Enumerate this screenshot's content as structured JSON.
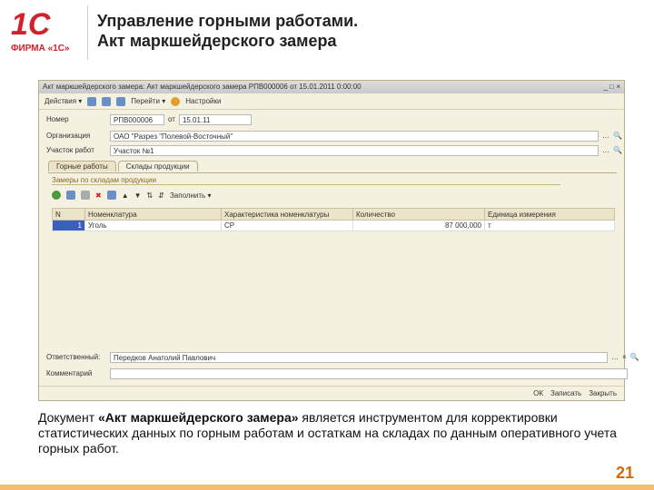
{
  "logo": {
    "mark": "1С",
    "text": "ФИРМА «1С»"
  },
  "title": {
    "line1": "Управление горными работами.",
    "line2": "Акт маркшейдерского замера"
  },
  "window": {
    "title": "Акт маркшейдерского замера: Акт маркшейдерского замера РПВ000006 от 15.01.2011 0:00:00",
    "toolbar": {
      "actions": "Действия ▾",
      "goto": "Перейти ▾",
      "settings": "Настройки"
    },
    "fields": {
      "number_label": "Номер",
      "number": "РПВ000006",
      "date_label": "от",
      "date": "15.01.11",
      "org_label": "Организация",
      "org": "ОАО \"Разрез \"Полевой-Восточный\"",
      "site_label": "Участок работ",
      "site": "Участок №1"
    },
    "tabs": [
      "Горные работы",
      "Склады продукции"
    ],
    "section": "Замеры по складам продукции",
    "fill": "Заполнить ▾",
    "columns": [
      "N",
      "Номенклатура",
      "Характеристика номенклатуры",
      "Количество",
      "Единица измерения"
    ],
    "rows": [
      {
        "n": "1",
        "item": "Уголь",
        "char": "СР",
        "qty": "87 000,000",
        "unit": "т"
      }
    ],
    "responsible_label": "Ответственный:",
    "responsible": "Передков Анатолий Павлович",
    "comment_label": "Комментарий",
    "buttons": {
      "ok": "ОК",
      "save": "Записать",
      "close": "Закрыть"
    }
  },
  "description": {
    "prefix": "Документ ",
    "bold": "«Акт маркшейдерского замера»",
    "rest": " является инструментом для корректировки статистических данных по горным работам и остаткам на складах по данным оперативного учета горных работ."
  },
  "page": "21"
}
